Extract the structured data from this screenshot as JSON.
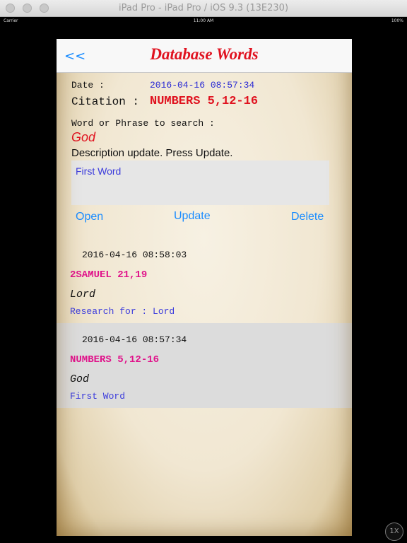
{
  "window": {
    "title": "iPad Pro - iPad Pro / iOS 9.3 (13E230)"
  },
  "statusbar": {
    "carrier": "Carrier",
    "time": "11:00 AM",
    "battery": "100%"
  },
  "navbar": {
    "back_label": "<<",
    "title": "Database Words"
  },
  "detail": {
    "date_label": "Date :",
    "date_value": "2016-04-16 08:57:34",
    "citation_label": "Citation :",
    "citation_value": "NUMBERS 5,12-16",
    "search_label": "Word or Phrase to search :",
    "search_word": "God",
    "description_hint": "Description update. Press Update.",
    "description_value": "First Word"
  },
  "actions": {
    "open_label": "Open",
    "update_label": "Update",
    "delete_label": "Delete"
  },
  "entries": [
    {
      "date": "2016-04-16 08:58:03",
      "citation": "2SAMUEL 21,19",
      "word": "Lord",
      "description": "Research for : Lord",
      "selected": false
    },
    {
      "date": "2016-04-16 08:57:34",
      "citation": "NUMBERS 5,12-16",
      "word": "God",
      "description": "First Word",
      "selected": true
    }
  ],
  "zoom": {
    "label": "1X"
  },
  "colors": {
    "accent_blue": "#1a8cff",
    "title_red": "#e0121f",
    "citation_pink": "#e0128a",
    "value_blue": "#2a2ad4"
  }
}
